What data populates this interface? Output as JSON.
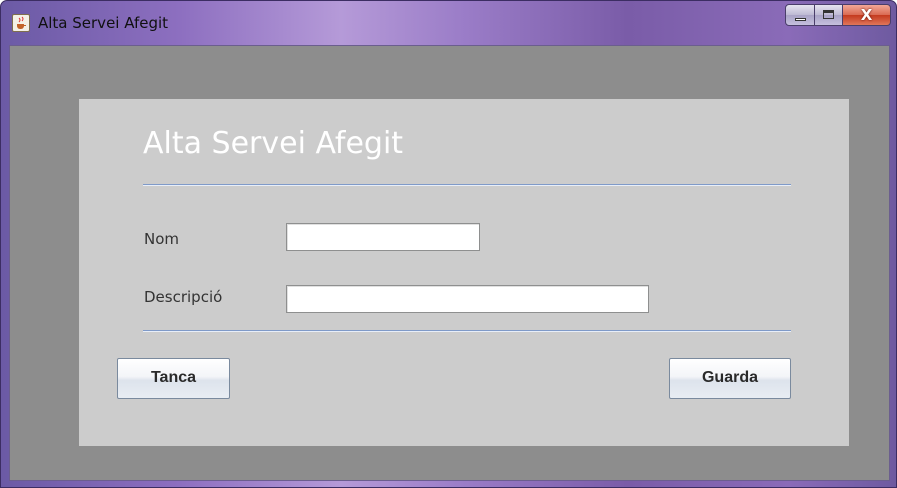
{
  "window": {
    "title": "Alta Servei Afegit",
    "icon": "java-cup-icon",
    "close_glyph": "X"
  },
  "form": {
    "heading": "Alta Servei Afegit",
    "fields": {
      "nom": {
        "label": "Nom",
        "value": ""
      },
      "descripcio": {
        "label": "Descripció",
        "value": ""
      }
    }
  },
  "buttons": {
    "tanca": "Tanca",
    "guarda": "Guarda"
  },
  "colors": {
    "panel_background": "#cccccc",
    "outer_background": "#8d8d8d",
    "separator": "#7f9ac8",
    "heading_text": "#ffffff"
  }
}
